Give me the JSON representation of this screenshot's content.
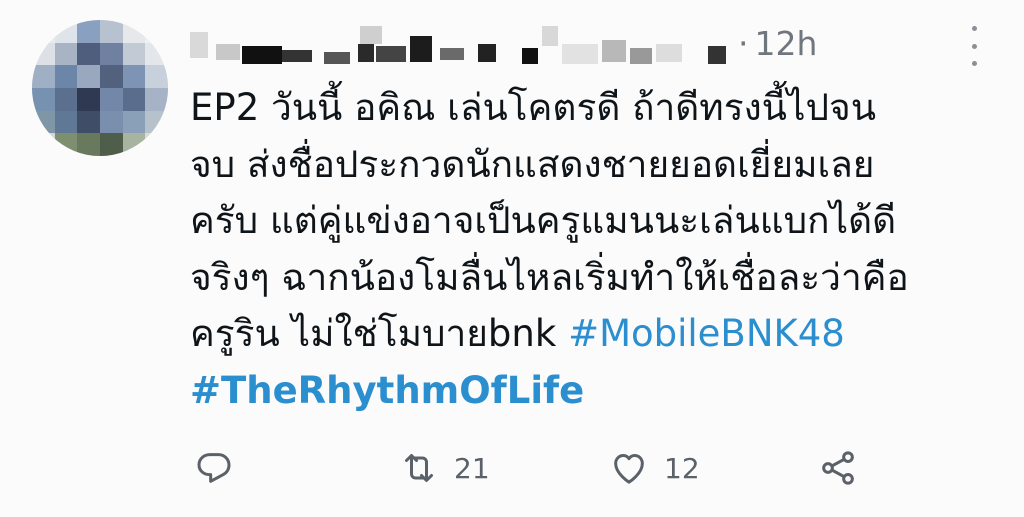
{
  "tweet": {
    "time": "12h",
    "separator": "·",
    "lines": [
      "EP2  วันนี้ อคิณ เล่นโคตรดี ถ้าดีทรงนี้ไปจน",
      "จบ ส่งชื่อประกวดนักแสดงชายยอดเยี่ยมเลย",
      "ครับ แต่คู่แข่งอาจเป็นครูแมนนะเล่นแบกได้ดี",
      "จริงๆ ฉากน้องโมลื่นไหลเริ่มทำให้เชื่อละว่าคือ",
      "ครูริน ไม่ใช่โมบายbnk "
    ],
    "hashtag1": "#MobileBNK48",
    "hashtag2": "#TheRhythmOfLife"
  },
  "actions": {
    "reply_icon": "reply-icon",
    "retweet_icon": "retweet-icon",
    "retweet_count": "21",
    "like_icon": "heart-icon",
    "like_count": "12",
    "share_icon": "share-icon"
  },
  "colors": {
    "text": "#0f1419",
    "muted": "#6f767d",
    "hashtag": "#2a8ecf"
  }
}
